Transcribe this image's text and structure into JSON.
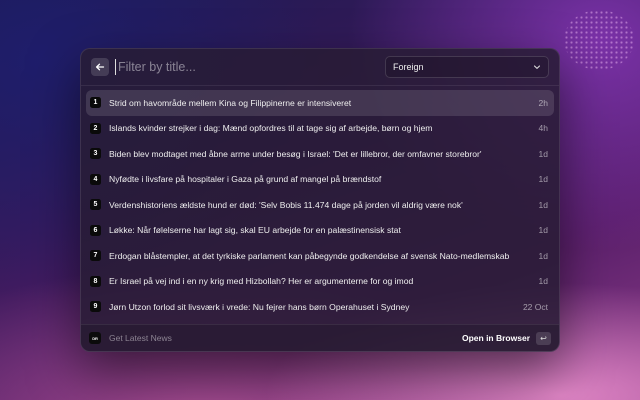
{
  "search": {
    "placeholder": "Filter by title..."
  },
  "dropdown": {
    "selected": "Foreign"
  },
  "items": [
    {
      "num": "1",
      "title": "Strid om havområde mellem Kina og Filippinerne er intensiveret",
      "time": "2h"
    },
    {
      "num": "2",
      "title": "Islands kvinder strejker i dag: Mænd opfordres til at tage sig af arbejde, børn og hjem",
      "time": "4h"
    },
    {
      "num": "3",
      "title": "Biden blev modtaget med åbne arme under besøg i Israel: 'Det er lillebror, der omfavner storebror'",
      "time": "1d"
    },
    {
      "num": "4",
      "title": "Nyfødte i livsfare på hospitaler i Gaza på grund af mangel på brændstof",
      "time": "1d"
    },
    {
      "num": "5",
      "title": "Verdenshistoriens ældste hund er død: 'Selv Bobis 11.474 dage på jorden vil aldrig være nok'",
      "time": "1d"
    },
    {
      "num": "6",
      "title": "Løkke: Når følelserne har lagt sig, skal EU arbejde for en palæstinensisk stat",
      "time": "1d"
    },
    {
      "num": "7",
      "title": "Erdogan blåstempler, at det tyrkiske parlament kan påbegynde godkendelse af svensk Nato-medlemskab",
      "time": "1d"
    },
    {
      "num": "8",
      "title": "Er Israel på vej ind i en ny krig med Hizbollah? Her er argumenterne for og imod",
      "time": "1d"
    },
    {
      "num": "9",
      "title": "Jørn Utzon forlod sit livsværk i vrede: Nu fejrer hans børn Operahuset i Sydney",
      "time": "22 Oct"
    }
  ],
  "footer": {
    "app_icon_text": "DR",
    "app_name": "Get Latest News",
    "action_label": "Open in Browser",
    "action_key": "↩"
  },
  "icons": {
    "back": "arrow-left-icon",
    "chevron": "chevron-down-icon"
  }
}
